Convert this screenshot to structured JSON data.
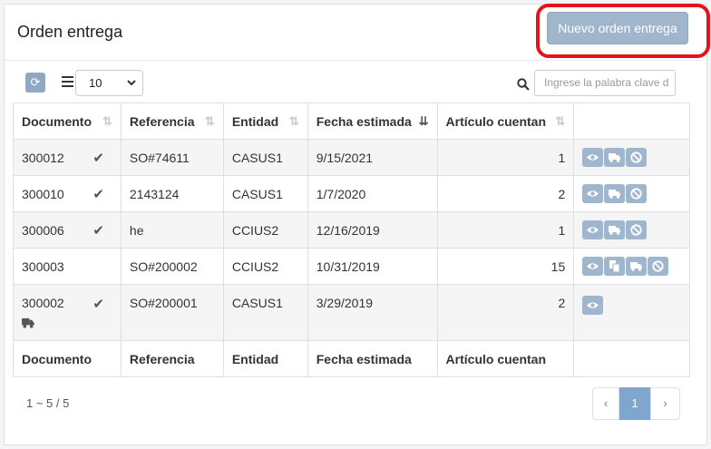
{
  "header": {
    "title": "Orden entrega",
    "new_button": "Nuevo orden entrega"
  },
  "toolbar": {
    "page_size": "10",
    "search_placeholder": "Ingrese la palabra clave d"
  },
  "columns": [
    "Documento",
    "Referencia",
    "Entidad",
    "Fecha estimada",
    "Artículo cuentan",
    ""
  ],
  "rows": [
    {
      "documento": "300012",
      "referencia": "SO#74611",
      "entidad": "CASUS1",
      "fecha": "9/15/2021",
      "cuentan": "1",
      "checked": true
    },
    {
      "documento": "300010",
      "referencia": "2143124",
      "entidad": "CASUS1",
      "fecha": "1/7/2020",
      "cuentan": "2",
      "checked": true
    },
    {
      "documento": "300006",
      "referencia": "he",
      "entidad": "CCIUS2",
      "fecha": "12/16/2019",
      "cuentan": "1",
      "checked": true
    },
    {
      "documento": "300003",
      "referencia": "SO#200002",
      "entidad": "CCIUS2",
      "fecha": "10/31/2019",
      "cuentan": "15",
      "checked": false
    },
    {
      "documento": "300002",
      "referencia": "SO#200001",
      "entidad": "CASUS1",
      "fecha": "3/29/2019",
      "cuentan": "2",
      "checked": true
    }
  ],
  "footer_columns": [
    "Documento",
    "Referencia",
    "Entidad",
    "Fecha estimada",
    "Artículo cuentan"
  ],
  "pagination": {
    "info": "1 ~ 5 / 5",
    "prev": "‹",
    "current": "1",
    "next": "›"
  },
  "colors": {
    "button": "#9fb6cc",
    "highlight": "#e4141b",
    "active_page": "#7ea6cf"
  }
}
